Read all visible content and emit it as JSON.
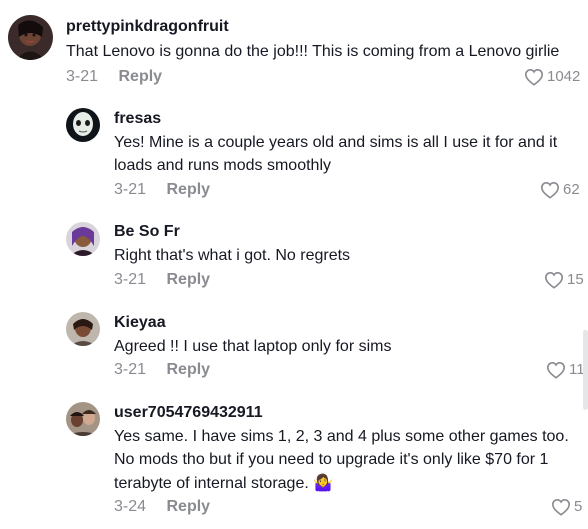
{
  "comments": [
    {
      "username": "prettypinkdragonfruit",
      "text": "That Lenovo is gonna do the job!!! This is coming from a Lenovo girlie",
      "date": "3-21",
      "reply": "Reply",
      "likes": "1042"
    },
    {
      "username": "fresas",
      "text": "Yes! Mine is a couple years old and sims is all I use it for and it loads and runs mods smoothly",
      "date": "3-21",
      "reply": "Reply",
      "likes": "62"
    },
    {
      "username": "Be So Fr",
      "text": "Right that's what i got. No regrets",
      "date": "3-21",
      "reply": "Reply",
      "likes": "15"
    },
    {
      "username": "Kieyaa",
      "text": "Agreed !! I use that laptop only for sims",
      "date": "3-21",
      "reply": "Reply",
      "likes": "11"
    },
    {
      "username": "user7054769432911",
      "text": "Yes same. I have sims 1, 2, 3 and 4 plus some other games too. No mods tho but if you need to upgrade it's only like $70 for 1 terabyte of internal storage.",
      "emoji": "🤷‍♀️",
      "date": "3-24",
      "reply": "Reply",
      "likes": "5"
    }
  ],
  "icons": {
    "like": "heart-outline-icon"
  },
  "colors": {
    "text": "#161823",
    "secondary": "#8a8b91"
  }
}
